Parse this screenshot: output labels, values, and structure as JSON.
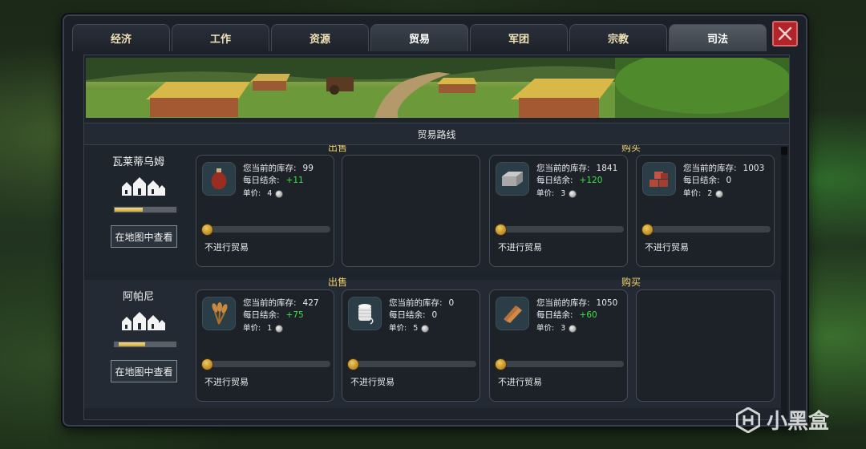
{
  "tabs": [
    {
      "label": "经济"
    },
    {
      "label": "工作"
    },
    {
      "label": "资源"
    },
    {
      "label": "贸易"
    },
    {
      "label": "军团"
    },
    {
      "label": "宗教"
    },
    {
      "label": "司法"
    }
  ],
  "active_tab": "贸易",
  "routes_title": "贸易路线",
  "labels": {
    "sell": "出售",
    "buy": "购买",
    "stock": "您当前的库存:",
    "daily": "每日结余:",
    "price": "单价:",
    "no_trade": "不进行贸易",
    "view_on_map": "在地图中查看"
  },
  "routes": [
    {
      "city": "瓦莱蒂乌姆",
      "population_fill": 0.45,
      "sell": [
        {
          "item": "wine-amphora-icon",
          "stock": "99",
          "daily": "+11",
          "price": "4",
          "slider": 0
        }
      ],
      "buy": [
        {
          "item": "stone-block-icon",
          "stock": "1841",
          "daily": "+120",
          "price": "3",
          "slider": 0
        },
        {
          "item": "bricks-icon",
          "stock": "1003",
          "daily": "0",
          "price": "2",
          "slider": 0
        }
      ]
    },
    {
      "city": "阿帕尼",
      "population_fill": 0.42,
      "sell": [
        {
          "item": "wheat-icon",
          "stock": "427",
          "daily": "+75",
          "price": "1",
          "slider": 0
        },
        {
          "item": "thread-spool-icon",
          "stock": "0",
          "daily": "0",
          "price": "5",
          "slider": 0
        }
      ],
      "buy": [
        {
          "item": "wood-planks-icon",
          "stock": "1050",
          "daily": "+60",
          "price": "3",
          "slider": 0
        }
      ]
    }
  ],
  "watermark": "小黑盒",
  "colors": {
    "accent_gold": "#f3d46a",
    "positive_green": "#3fe04a",
    "close_red": "#b3232a"
  }
}
